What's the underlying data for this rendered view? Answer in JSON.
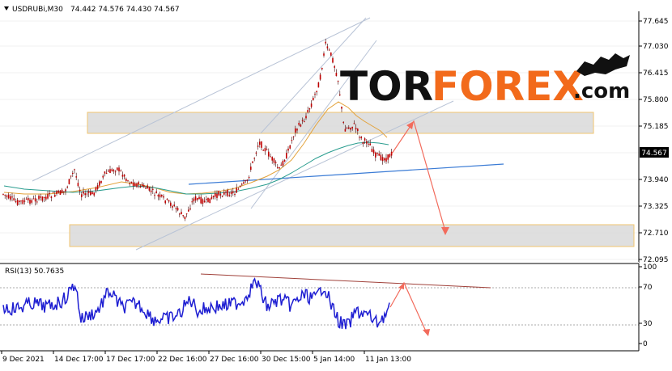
{
  "header": {
    "symbol": "USDRUBi,M30",
    "ohlc": "74.442 74.576 74.430 74.567"
  },
  "logo": {
    "part1": "TOR",
    "part2": "FOREX",
    "part3": ".com",
    "mascot_icon": "bull-bear-icon"
  },
  "colors": {
    "background": "#ffffff",
    "grid": "#e6e6e6",
    "candle": "#c00000",
    "rsi_line": "#1e1ed2",
    "trendline": "#3a7bd5",
    "channel": "#b8c3d6",
    "arrow": "#f26b5c",
    "zone_fill": "#dcdcdc",
    "zone_border": "#f0c060",
    "ma_orange": "#e3a23a",
    "ma_teal": "#2a9d8f",
    "logo_accent": "#f26a1b"
  },
  "price_axis": {
    "ticks": [
      "77.645",
      "77.030",
      "76.415",
      "75.800",
      "75.185",
      "74.567",
      "73.940",
      "73.325",
      "72.710",
      "72.095"
    ],
    "current": "74.567"
  },
  "rsi": {
    "label": "RSI(13) 50.7635",
    "ticks": [
      "100",
      "70",
      "30",
      "0"
    ]
  },
  "time_axis": {
    "labels": [
      "9 Dec 2021",
      "14 Dec 17:00",
      "17 Dec 17:00",
      "22 Dec 16:00",
      "27 Dec 16:00",
      "30 Dec 15:00",
      "5 Jan 14:00",
      "11 Jan 13:00"
    ]
  },
  "chart_data": {
    "type": "candlestick",
    "symbol": "USDRUBi",
    "timeframe": "M30",
    "ylim": [
      72.095,
      77.645
    ],
    "last_price": 74.567,
    "zones": [
      {
        "name": "resistance-zone",
        "from": 74.97,
        "to": 75.45
      },
      {
        "name": "support-zone",
        "from": 72.45,
        "to": 72.93
      }
    ],
    "forecast_path": [
      74.567,
      75.45,
      72.75
    ],
    "rsi_period": 13,
    "rsi_value": 50.7635,
    "rsi_levels": [
      30,
      70
    ],
    "rsi_forecast_path": [
      50.76,
      85,
      15
    ]
  }
}
